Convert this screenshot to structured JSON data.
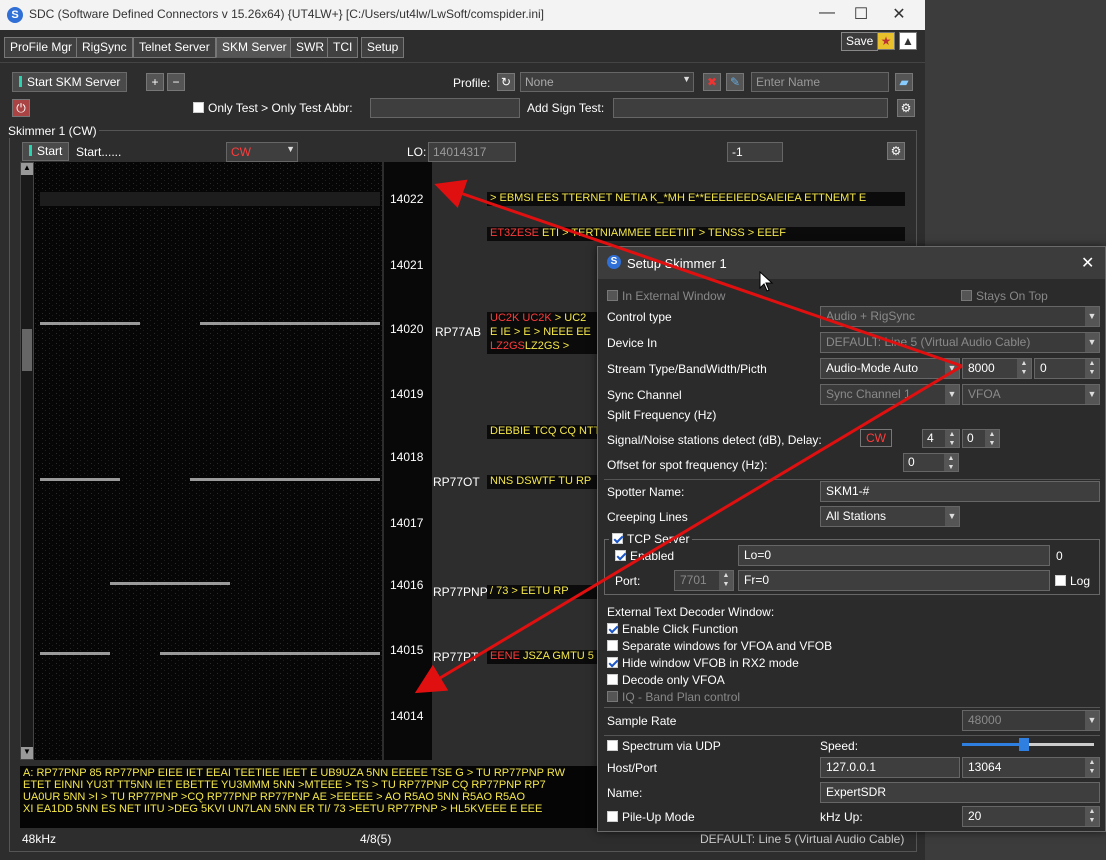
{
  "window": {
    "title": "SDC (Software Defined Connectors v 15.26x64) {UT4LW+} [C:/Users/ut4lw/LwSoft/comspider.ini]",
    "minimize": "—",
    "maximize": "☐",
    "close": "✕"
  },
  "tabs": [
    "ProFile Mgr",
    "RigSync",
    "Telnet Server",
    "SKM Server",
    "SWR",
    "TCI",
    "Setup"
  ],
  "top_right": {
    "save": "Save",
    "star": "★"
  },
  "toolbar": {
    "start_label": "Start SKM Server",
    "plus": "+",
    "minus": "−",
    "profile_label": "Profile:",
    "profile_value": "None",
    "enter_name_placeholder": "Enter Name"
  },
  "testbar": {
    "only_test": "Only Test > Only Test Abbr:",
    "add_sign": "Add Sign Test:"
  },
  "skimmer": {
    "group": "Skimmer 1 (CW)",
    "start": "Start",
    "status": "Start......",
    "mode": "CW",
    "lo_label": "LO:",
    "lo_value": "14014317",
    "offset": "-1"
  },
  "freqs": [
    "14022",
    "14021",
    "14020",
    "14019",
    "14018",
    "14017",
    "14016",
    "14015",
    "14014"
  ],
  "calls": [
    {
      "c": "RP77AB"
    },
    {
      "c": "RP77OT"
    },
    {
      "c": "RP77PNP"
    },
    {
      "c": "RP77PT"
    }
  ],
  "decoders": [
    {
      "y": "> EBMSI EES TTERNET NETIA K_*MH E**EEEEIEEDSAIEIEA ETTNEMT E",
      "r": ""
    },
    {
      "r": "ET3ZESE",
      "y": " ETI > TERTNIAMMEE EEETIIT > TENSS > EEEF"
    },
    {
      "r": "UC2K UC2K",
      "y": " > UC2"
    },
    {
      "r": "",
      "y": "E IE > E > NEEE EE"
    },
    {
      "r": "LZ2GS",
      "y": "LZ2GS >"
    },
    {
      "r": "",
      "y": "DEBBIE TCQ CQ NTT"
    },
    {
      "r": "",
      "y": "NNS DSWTF TU RP"
    },
    {
      "r": "",
      "y": "/ 73 > EETU RP"
    },
    {
      "r": "EENE",
      "y": " JSZA GMTU 5"
    }
  ],
  "textpane": [
    "A: RP77PNP 85 RP77PNP EIEE IET EEAI TEETIEE IEET E UB9UZA 5NN EEEEE TSE G > TU RP77PNP RW",
    "ETET EINNI YU3T TT5NN IET EBETTE YU3MMM 5NN >MTEEE > TS > TU RP77PNP CQ RP77PNP RP7",
    "UA0UR 5NN >I > TU RP77PNP >CQ RP77PNP RP77PNP AE >EEEEE > AO R5AO 5NN R5AO R5AO",
    "XI EA1DD 5NN ES NET IITU >DEG 5KVI UN7LAN 5NN ER TI/ 73 >EETU RP77PNP > HL5KVEEE E EEE"
  ],
  "status": {
    "bandwidth": "48kHz",
    "count": "4/8(5)",
    "device": "DEFAULT: Line 5 (Virtual Audio Cable)"
  },
  "dialog": {
    "title": "Setup Skimmer 1",
    "in_external": "In External Window",
    "stays_on_top": "Stays On Top",
    "control_type_label": "Control type",
    "control_type_value": "Audio + RigSync",
    "device_in_label": "Device In",
    "device_in_value": "DEFAULT: Line 5 (Virtual Audio Cable)",
    "stream_label": "Stream Type/BandWidth/Picth",
    "stream_value": "Audio-Mode Auto",
    "bw_value": "8000",
    "pitch_value": "0",
    "sync_label": "Sync Channel",
    "sync_value": "Sync Channel 1",
    "vfo_value": "VFOA",
    "split_label": "Split Frequency (Hz)",
    "snr_label": "Signal/Noise stations detect (dB), Delay:",
    "snr_mode": "CW",
    "snr_value": "4",
    "delay_value": "0",
    "offset_label": "Offset for spot frequency (Hz):",
    "offset_value": "0",
    "spotter_label": "Spotter Name:",
    "spotter_value": "SKM1-#",
    "creeping_label": "Creeping Lines",
    "creeping_value": "All Stations",
    "tcp_label": "TCP Server",
    "enabled_label": "Enabled",
    "lo_field": "Lo=0",
    "lo_count": "0",
    "port_label": "Port:",
    "port_value": "7701",
    "fr_field": "Fr=0",
    "log_label": "Log",
    "ext_label": "External Text Decoder Window:",
    "opt1": "Enable Click Function",
    "opt2": "Separate windows for VFOA and VFOB",
    "opt3": "Hide window VFOB in RX2 mode",
    "opt4": "Decode only VFOA",
    "opt5": "IQ - Band Plan control",
    "sample_label": "Sample Rate",
    "sample_value": "48000",
    "spectrum_label": "Spectrum via UDP",
    "speed_label": "Speed:",
    "host_label": "Host/Port",
    "host_value": "127.0.0.1",
    "host_port": "13064",
    "name_label": "Name:",
    "name_value": "ExpertSDR",
    "pileup_label": "Pile-Up Mode",
    "khz_label": "kHz Up:",
    "khz_value": "20"
  }
}
